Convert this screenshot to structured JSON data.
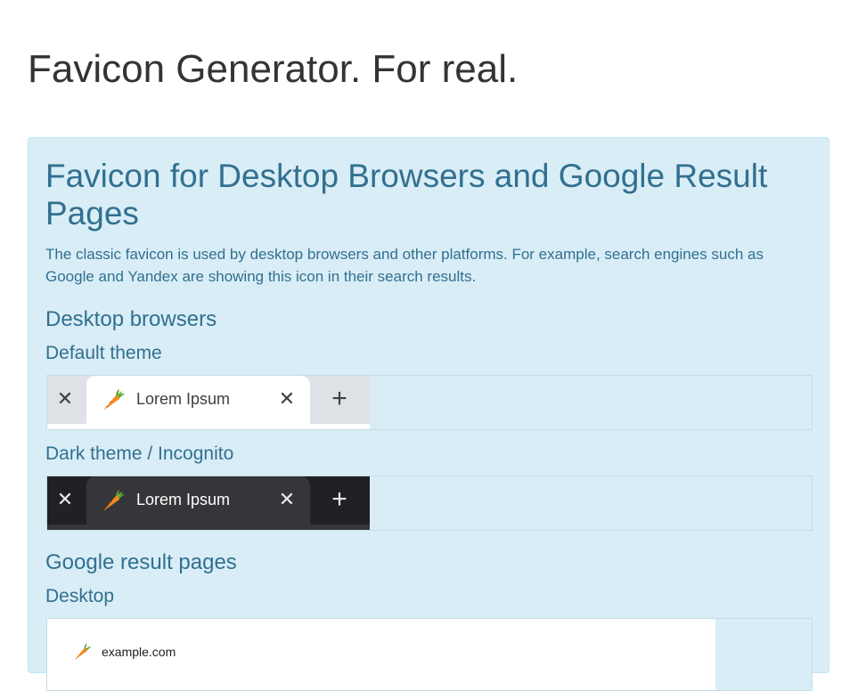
{
  "page": {
    "title": "Favicon Generator. For real."
  },
  "panel": {
    "title": "Favicon for Desktop Browsers and Google Result Pages",
    "description": "The classic favicon is used by desktop browsers and other platforms. For example, search engines such as Google and Yandex are showing this icon in their search results.",
    "desktop_heading": "Desktop browsers",
    "default_theme_label": "Default theme",
    "dark_theme_label": "Dark theme / Incognito",
    "google_heading": "Google result pages",
    "google_desktop_label": "Desktop"
  },
  "tabs": {
    "close_glyph": "✕",
    "tab_label": "Lorem Ipsum",
    "new_tab_glyph": "+",
    "favicon_icon": "carrot-icon"
  },
  "serp": {
    "url": "example.com",
    "favicon_icon": "carrot-icon"
  },
  "colors": {
    "panel_bg": "#d9edf7",
    "panel_text": "#31708f",
    "carrot_orange": "#f58a1f",
    "carrot_leaves": "#5aa02c"
  }
}
